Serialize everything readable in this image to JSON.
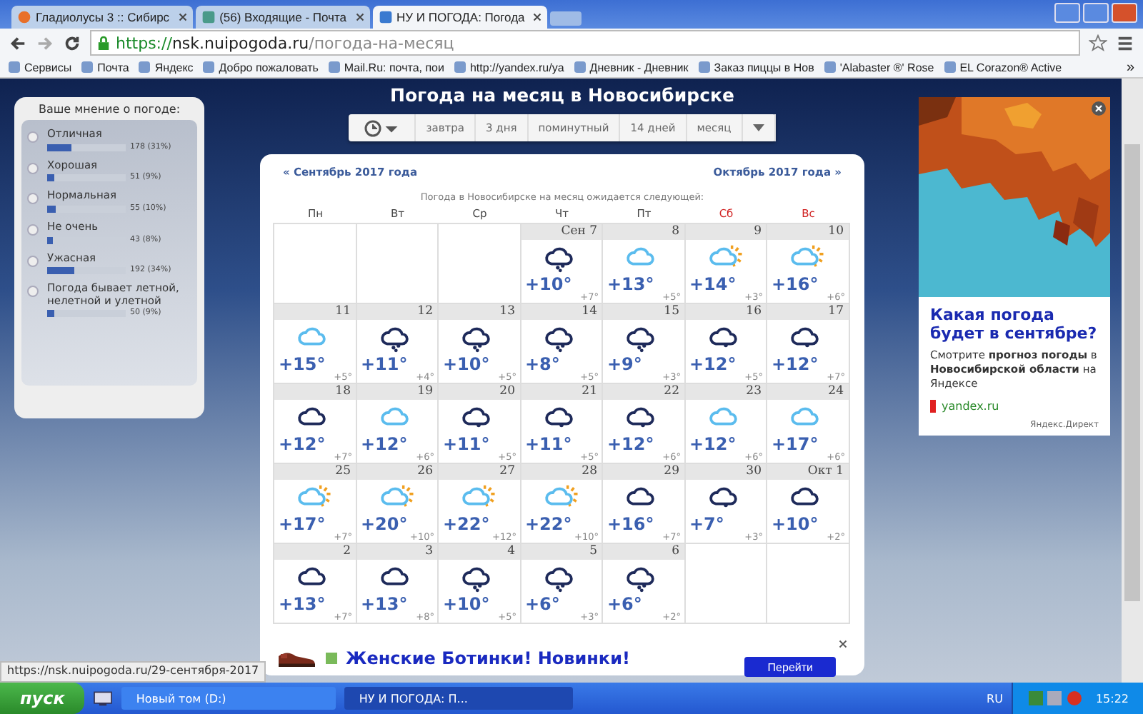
{
  "browser": {
    "tabs": [
      {
        "title": "Гладиолусы 3 :: Сибирс",
        "selected": false,
        "kind": "fire"
      },
      {
        "title": "(56) Входящие - Почта",
        "selected": false,
        "kind": "mail"
      },
      {
        "title": "НУ И ПОГОДА: Погода",
        "selected": true,
        "kind": "weather"
      }
    ],
    "address": {
      "secure": "https://",
      "host": "nsk.nuipogoda.ru",
      "path": "/погода-на-месяц"
    },
    "bookmarks": [
      "Сервисы",
      "Почта",
      "Яндекс",
      "Добро пожаловать",
      "Mail.Ru: почта, пои",
      "http://yandex.ru/ya",
      "Дневник - Дневник",
      "Заказ пиццы в Нов",
      "'Alabaster ®' Rose",
      "EL Corazon® Active"
    ],
    "bookmarks_more": "»"
  },
  "poll": {
    "title": "Ваше мнение о погоде:",
    "options": [
      {
        "label": "Отличная",
        "count": "178 (31%)",
        "level": 0.31,
        "selected": false
      },
      {
        "label": "Хорошая",
        "count": "51 (9%)",
        "level": 0.09,
        "selected": false
      },
      {
        "label": "Нормальная",
        "count": "55 (10%)",
        "level": 0.1,
        "selected": false
      },
      {
        "label": "Не очень",
        "count": "43 (8%)",
        "level": 0.08,
        "selected": false
      },
      {
        "label": "Ужасная",
        "count": "192 (34%)",
        "level": 0.34,
        "selected": false
      },
      {
        "label": "Погода бывает летной, нелетной и улетной",
        "count": "50 (9%)",
        "level": 0.09,
        "selected": false
      }
    ]
  },
  "page_title": "Погода на месяц в Новосибирске",
  "toolbar": [
    "завтра",
    "3 дня",
    "поминутный",
    "14 дней",
    "месяц"
  ],
  "calendar": {
    "prev_link": "« Сентябрь 2017 года",
    "next_link": "Октябрь 2017 года »",
    "subtitle": "Погода в Новосибирске на месяц ожидается следующей:",
    "weekdays": [
      {
        "label": "Пн",
        "weekend": false
      },
      {
        "label": "Вт",
        "weekend": false
      },
      {
        "label": "Ср",
        "weekend": false
      },
      {
        "label": "Чт",
        "weekend": false
      },
      {
        "label": "Пт",
        "weekend": false
      },
      {
        "label": "Сб",
        "weekend": true
      },
      {
        "label": "Вс",
        "weekend": true
      }
    ],
    "weeks": [
      [
        {
          "kind": "empty"
        },
        {
          "kind": "empty"
        },
        {
          "kind": "empty"
        },
        {
          "kind": "rain",
          "date": "Сен 7",
          "day": "+10°",
          "night": "+7°"
        },
        {
          "kind": "cloud",
          "date": "8",
          "day": "+13°",
          "night": "+5°"
        },
        {
          "kind": "sun",
          "date": "9",
          "day": "+14°",
          "night": "+3°"
        },
        {
          "kind": "sun",
          "date": "10",
          "day": "+16°",
          "night": "+6°"
        }
      ],
      [
        {
          "kind": "cloud",
          "date": "11",
          "day": "+15°",
          "night": "+5°"
        },
        {
          "kind": "rain",
          "date": "12",
          "day": "+11°",
          "night": "+4°"
        },
        {
          "kind": "rain",
          "date": "13",
          "day": "+10°",
          "night": "+5°"
        },
        {
          "kind": "rain",
          "date": "14",
          "day": "+8°",
          "night": "+5°"
        },
        {
          "kind": "rain",
          "date": "15",
          "day": "+9°",
          "night": "+3°"
        },
        {
          "kind": "drizzle",
          "date": "16",
          "day": "+12°",
          "night": "+5°"
        },
        {
          "kind": "drizzle",
          "date": "17",
          "day": "+12°",
          "night": "+7°"
        }
      ],
      [
        {
          "kind": "overcast",
          "date": "18",
          "day": "+12°",
          "night": "+7°"
        },
        {
          "kind": "cloud",
          "date": "19",
          "day": "+12°",
          "night": "+6°"
        },
        {
          "kind": "drizzle",
          "date": "20",
          "day": "+11°",
          "night": "+5°"
        },
        {
          "kind": "drizzle",
          "date": "21",
          "day": "+11°",
          "night": "+5°"
        },
        {
          "kind": "drizzle",
          "date": "22",
          "day": "+12°",
          "night": "+6°"
        },
        {
          "kind": "cloud",
          "date": "23",
          "day": "+12°",
          "night": "+6°"
        },
        {
          "kind": "cloud",
          "date": "24",
          "day": "+17°",
          "night": "+6°"
        }
      ],
      [
        {
          "kind": "sun",
          "date": "25",
          "day": "+17°",
          "night": "+7°"
        },
        {
          "kind": "sun",
          "date": "26",
          "day": "+20°",
          "night": "+10°"
        },
        {
          "kind": "sun",
          "date": "27",
          "day": "+22°",
          "night": "+12°"
        },
        {
          "kind": "sun",
          "date": "28",
          "day": "+22°",
          "night": "+10°"
        },
        {
          "kind": "overcast",
          "date": "29",
          "day": "+16°",
          "night": "+7°"
        },
        {
          "kind": "drizzle",
          "date": "30",
          "day": "+7°",
          "night": "+3°"
        },
        {
          "kind": "overcast",
          "date": "Окт 1",
          "day": "+10°",
          "night": "+2°"
        }
      ],
      [
        {
          "kind": "overcast",
          "date": "2",
          "day": "+13°",
          "night": "+7°"
        },
        {
          "kind": "overcast",
          "date": "3",
          "day": "+13°",
          "night": "+8°"
        },
        {
          "kind": "rain",
          "date": "4",
          "day": "+10°",
          "night": "+5°"
        },
        {
          "kind": "rain",
          "date": "5",
          "day": "+6°",
          "night": "+3°"
        },
        {
          "kind": "rain",
          "date": "6",
          "day": "+6°",
          "night": "+2°"
        },
        {
          "kind": "empty"
        },
        {
          "kind": "empty"
        }
      ]
    ]
  },
  "bottom_ad": {
    "title": "Женские Ботинки! Новинки!",
    "button": "Перейти"
  },
  "side_ad": {
    "title": "Какая погода будет в сентябре?",
    "text": "Смотрите **прогноз погоды** в **Новосибирской области** на Яндексе",
    "link": "yandex.ru",
    "source": "Яндекс.Директ"
  },
  "status_url": "https://nsk.nuipogoda.ru/29-сентября-2017",
  "taskbar": {
    "start": "пуск",
    "windows": [
      {
        "title": "Новый том (D:)",
        "selected": false
      },
      {
        "title": "НУ И ПОГОДА: П...",
        "selected": true
      }
    ],
    "lang": "RU",
    "time": "15:22"
  }
}
